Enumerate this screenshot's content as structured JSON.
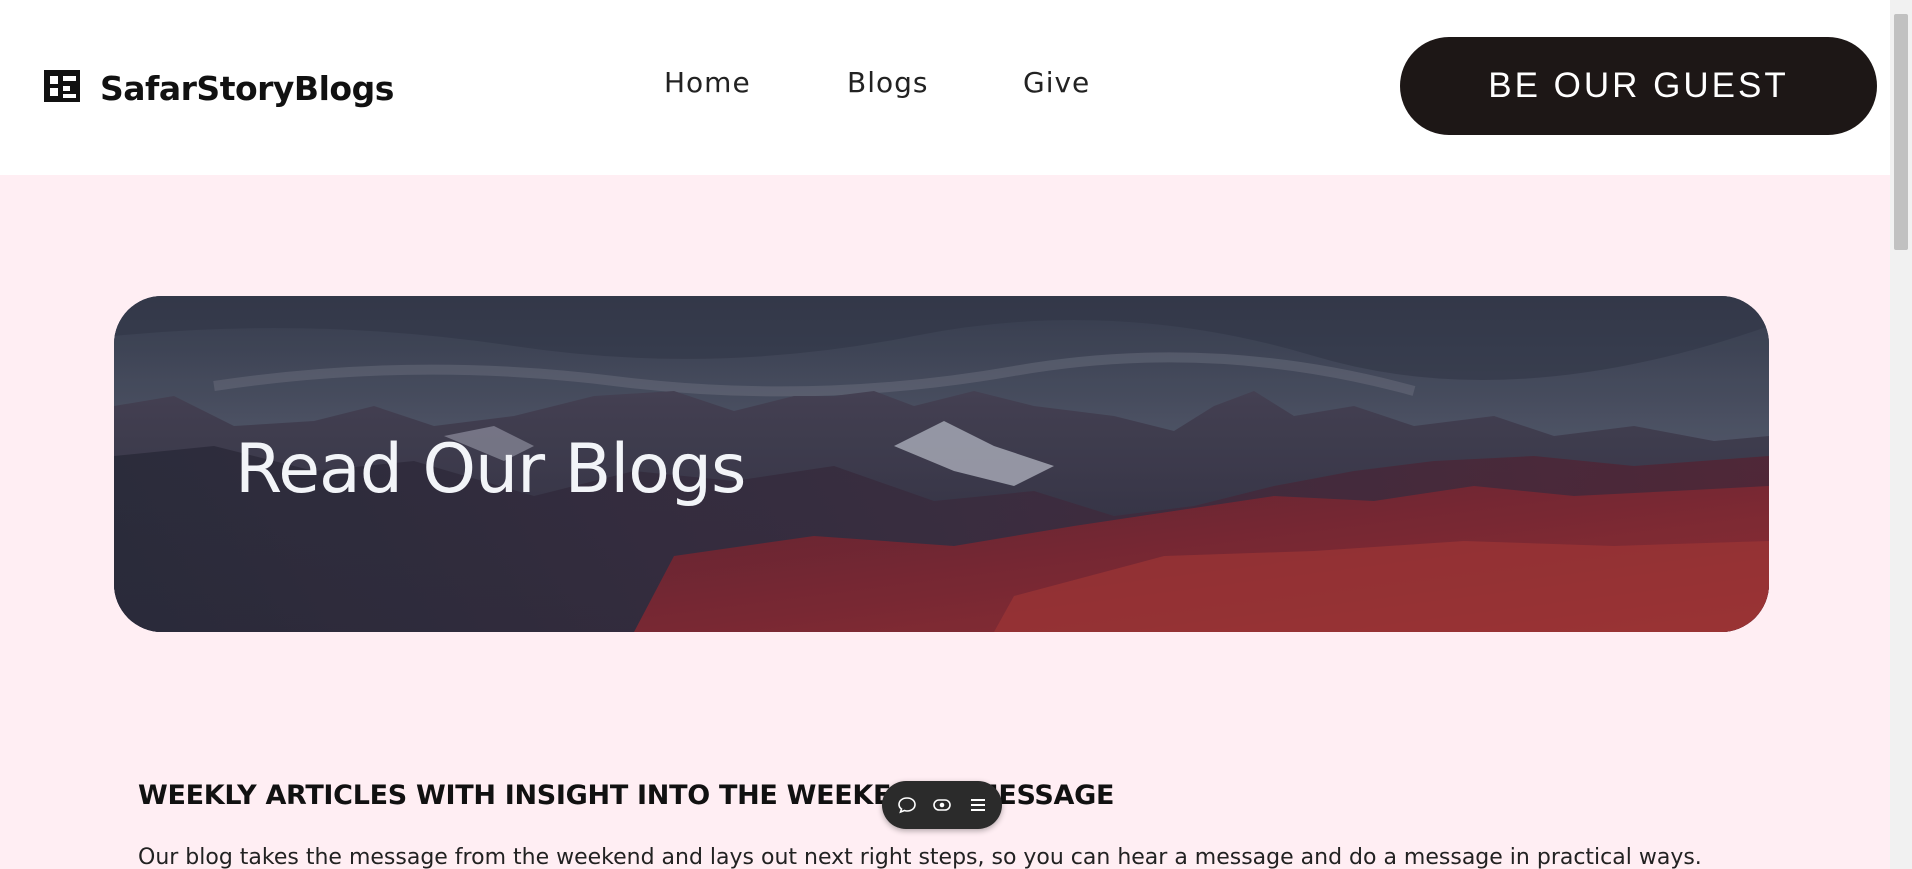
{
  "header": {
    "logo_text": "SafarStoryBlogs",
    "nav": {
      "home": "Home",
      "blogs": "Blogs",
      "give": "Give"
    },
    "cta_label": "BE OUR GUEST"
  },
  "hero": {
    "title": "Read Our Blogs"
  },
  "content": {
    "heading": "WEEKLY ARTICLES WITH INSIGHT INTO THE WEEKEND'S MESSAGE",
    "body": "Our blog takes the message from the weekend and lays out next right steps, so you can hear a message and do a message in practical ways."
  },
  "floating_toolbar": {
    "icons": [
      "chat-bubble-icon",
      "eye-icon",
      "menu-icon"
    ]
  },
  "colors": {
    "page_background": "#ffeef3",
    "header_background": "#ffffff",
    "cta_background": "#1d1716",
    "cta_text": "#ffffff"
  }
}
